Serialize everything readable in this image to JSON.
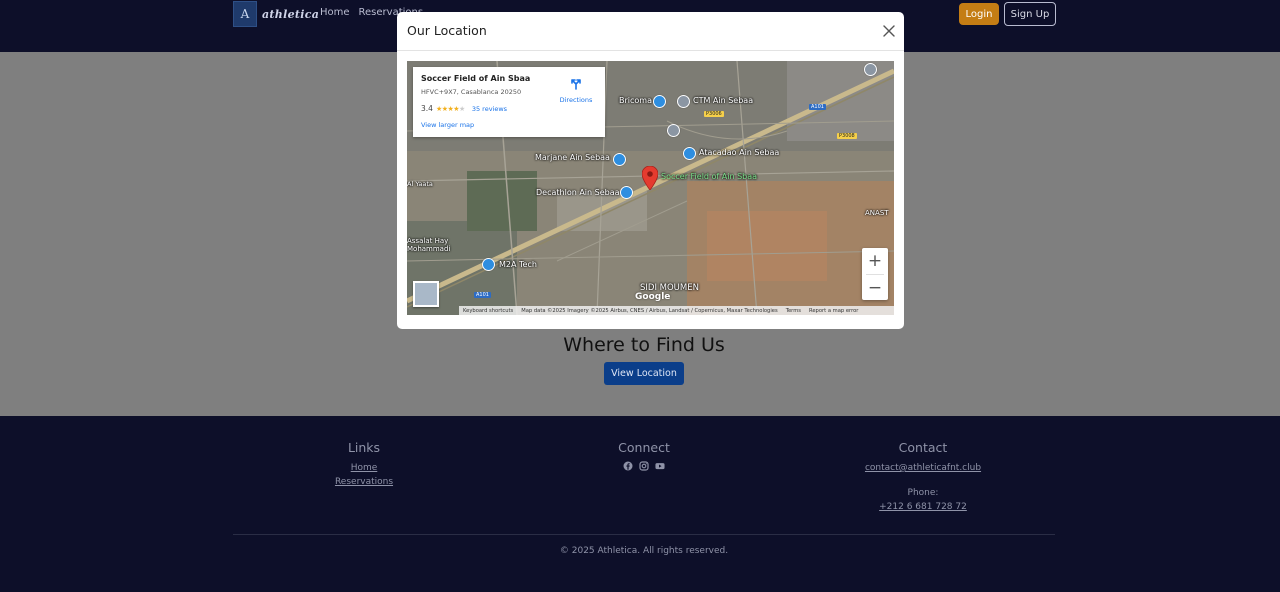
{
  "navbar": {
    "brand_logo_text": "A",
    "brand_name": "athletica",
    "links": [
      "Home",
      "Reservations"
    ],
    "login_label": "Login",
    "signup_label": "Sign Up",
    "bg_color": "#0d0f29",
    "login_color": "#c47d14"
  },
  "main": {
    "section_title": "Where to Find Us",
    "view_location_label": "View Location"
  },
  "modal": {
    "title": "Our Location",
    "close_icon": "close-icon",
    "map": {
      "place_name": "Soccer Field of Ain Sbaa",
      "address": "HFVC+9X7, Casablanca 20250",
      "rating": "3.4",
      "stars_filled": "★★★★",
      "stars_empty": "★",
      "reviews": "35 reviews",
      "directions_label": "Directions",
      "view_larger_map": "View larger map",
      "zoom_in": "+",
      "zoom_out": "−",
      "google_logo": "Google",
      "attribution": {
        "shortcuts": "Keyboard shortcuts",
        "map_data": "Map data ©2025 Imagery ©2025 Airbus, CNES / Airbus, Landsat / Copernicus, Maxar Technologies",
        "terms": "Terms",
        "report": "Report a map error"
      },
      "labels": {
        "bricoma": "Bricoma",
        "ctm": "CTM Ain Sebaa",
        "marjane": "Marjane Ain Sebaa",
        "atacadao": "Atacadao Ain Sebaa",
        "soccer_field": "Soccer Field of Ain Sbaa",
        "decathlon": "Decathlon Ain Sebaa",
        "m2a": "M2A Tech",
        "sidi_moumen": "SIDI MOUMEN",
        "ain_yaata": "Al Yaata",
        "hay_mohammadi": "Assalat Hay\nMohammadi",
        "anast": "ANAST"
      },
      "road_badges": {
        "a101_top": "A101",
        "p3006": "P3006",
        "p3008": "P3008",
        "a101_bottom": "A101"
      }
    }
  },
  "footer": {
    "links_title": "Links",
    "links": [
      "Home",
      "Reservations"
    ],
    "connect_title": "Connect",
    "social_icons": [
      "facebook-icon",
      "instagram-icon",
      "youtube-icon"
    ],
    "contact_title": "Contact",
    "email": "contact@athleticafnt.club",
    "phone_label": "Phone:",
    "phone": "+212 6 681 728 72",
    "copyright": "© 2025 Athletica. All rights reserved."
  }
}
